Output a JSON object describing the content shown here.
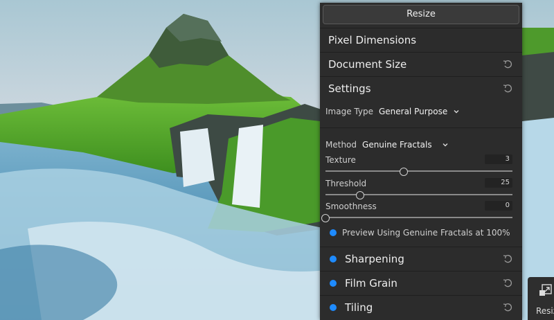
{
  "panel": {
    "title": "Resize",
    "sections": {
      "pixel_dimensions": "Pixel Dimensions",
      "document_size": "Document Size",
      "settings": "Settings"
    },
    "image_type": {
      "label": "Image Type",
      "value": "General Purpose"
    },
    "method": {
      "label": "Method",
      "value": "Genuine Fractals"
    },
    "sliders": {
      "texture": {
        "label": "Texture",
        "value": "3",
        "fraction": 0.42
      },
      "threshold": {
        "label": "Threshold",
        "value": "25",
        "fraction": 0.185
      },
      "smoothness": {
        "label": "Smoothness",
        "value": "0",
        "fraction": 0.0
      }
    },
    "preview": {
      "label": "Preview Using Genuine Fractals at 100%",
      "checked": true
    },
    "filters": [
      {
        "label": "Sharpening",
        "enabled": true
      },
      {
        "label": "Film Grain",
        "enabled": true
      },
      {
        "label": "Tiling",
        "enabled": true
      }
    ]
  },
  "side_button": {
    "label": "Resize"
  },
  "colors": {
    "accent": "#1e8bff",
    "panel_bg": "#2c2c2c"
  }
}
